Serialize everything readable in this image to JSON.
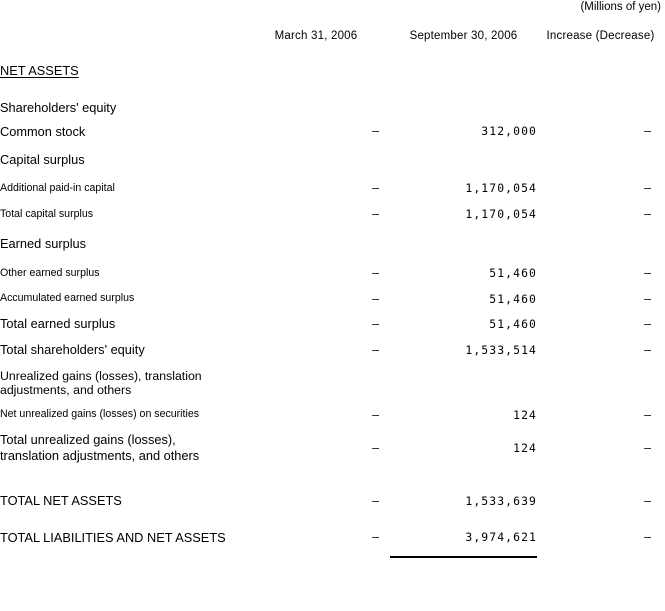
{
  "units_note": "(Millions of yen)",
  "header": {
    "label_col": "",
    "columns": [
      "March 31, 2006",
      "September 30, 2006",
      "Increase (Decrease)"
    ]
  },
  "section_title": "NET ASSETS",
  "rows": [
    {
      "label": "Shareholders' equity",
      "indent": 0,
      "size": "big",
      "march": "",
      "september": "",
      "increase": ""
    },
    {
      "label": "Common stock",
      "indent": 1,
      "size": "big",
      "march": "–",
      "september": "312,000",
      "increase": "–"
    },
    {
      "label": "Capital surplus",
      "indent": 1,
      "size": "big",
      "march": "",
      "september": "",
      "increase": ""
    },
    {
      "label": "Additional paid-in capital",
      "indent": 2,
      "size": "small",
      "march": "–",
      "september": "1,170,054",
      "increase": "–"
    },
    {
      "label": "Total capital surplus",
      "indent": 2,
      "size": "small",
      "march": "–",
      "september": "1,170,054",
      "increase": "–"
    },
    {
      "label": "Earned surplus",
      "indent": 1,
      "size": "big",
      "march": "",
      "september": "",
      "increase": ""
    },
    {
      "label": "Other earned surplus",
      "indent": 2,
      "size": "small",
      "march": "–",
      "september": "51,460",
      "increase": "–"
    },
    {
      "label": "Accumulated earned surplus",
      "indent": 3,
      "size": "small",
      "march": "–",
      "september": "51,460",
      "increase": "–"
    },
    {
      "label": "Total earned surplus",
      "indent": 1,
      "size": "big",
      "march": "–",
      "september": "51,460",
      "increase": "–"
    },
    {
      "label": "Total shareholders' equity",
      "indent": 1,
      "size": "big",
      "march": "–",
      "september": "1,533,514",
      "increase": "–"
    },
    {
      "label": "Unrealized gains (losses), translation adjustments, and others",
      "indent": 0,
      "size": "mid",
      "march": "",
      "september": "",
      "increase": ""
    },
    {
      "label": "Net unrealized gains (losses) on securities",
      "indent": 2,
      "size": "small",
      "march": "–",
      "september": "124",
      "increase": "–"
    },
    {
      "label": "Total unrealized gains (losses), translation adjustments, and others",
      "indent": 2,
      "size": "big",
      "march": "–",
      "september": "124",
      "increase": "–"
    }
  ],
  "totals": [
    {
      "label": "TOTAL NET ASSETS",
      "march": "–",
      "september": "1,533,639",
      "increase": "–"
    },
    {
      "label": "TOTAL LIABILITIES AND NET ASSETS",
      "march": "–",
      "september": "3,974,621",
      "increase": "–"
    }
  ]
}
